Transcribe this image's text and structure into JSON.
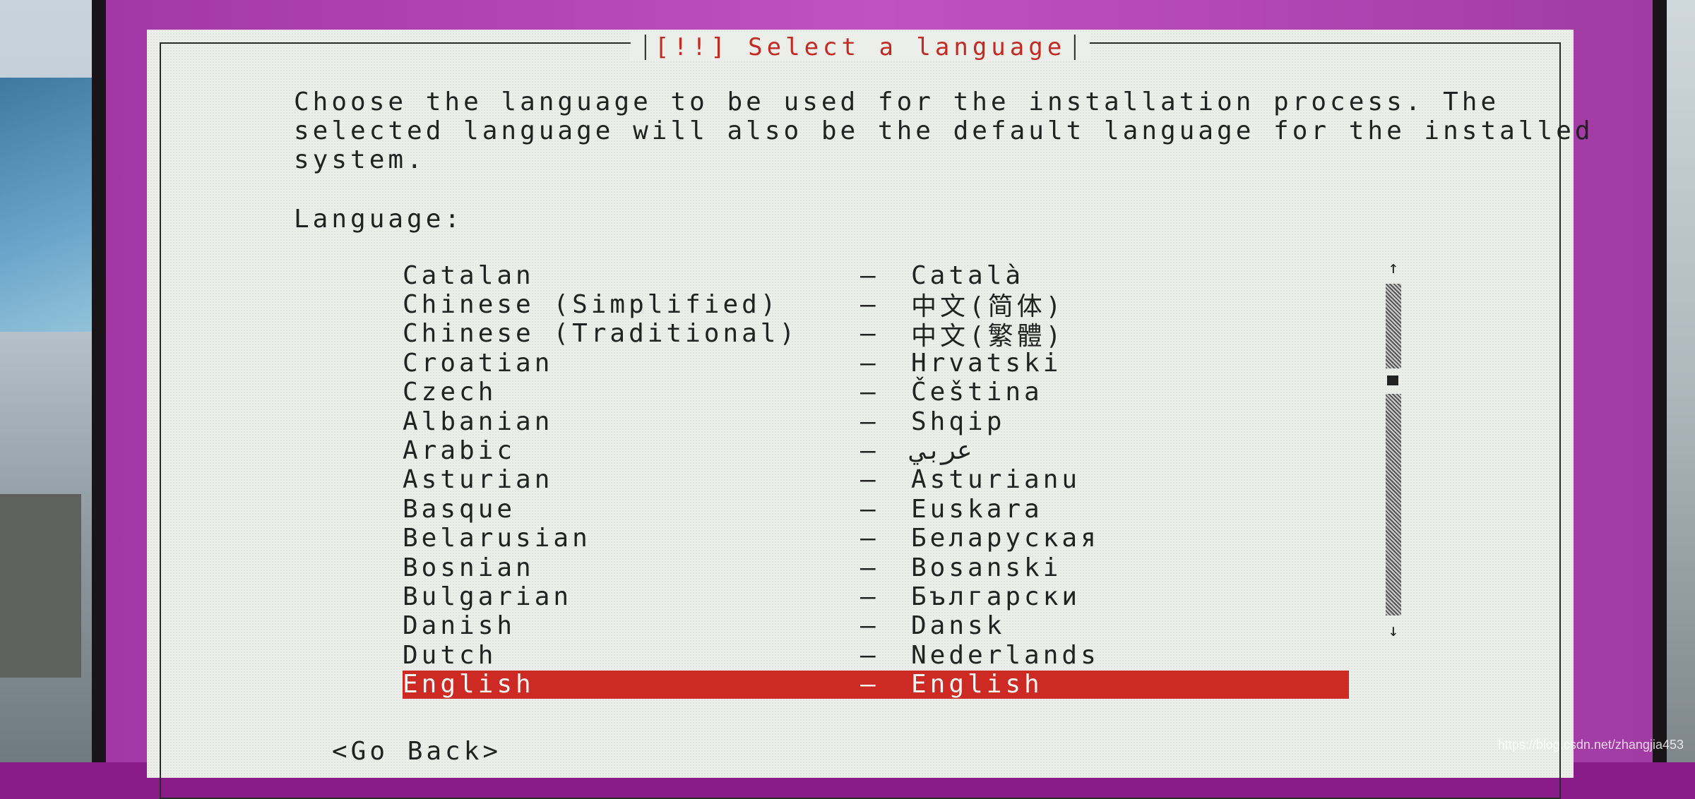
{
  "dialog": {
    "title": "[!!] Select a language",
    "description": "Choose the language to be used for the installation process. The\nselected language will also be the default language for the installed\nsystem.",
    "list_label": "Language:"
  },
  "languages": [
    {
      "name": "Catalan",
      "native": "Català"
    },
    {
      "name": "Chinese (Simplified)",
      "native": "中文(简体)"
    },
    {
      "name": "Chinese (Traditional)",
      "native": "中文(繁體)"
    },
    {
      "name": "Croatian",
      "native": "Hrvatski"
    },
    {
      "name": "Czech",
      "native": "Čeština"
    },
    {
      "name": "Albanian",
      "native": "Shqip"
    },
    {
      "name": "Arabic",
      "native": "عربي"
    },
    {
      "name": "Asturian",
      "native": "Asturianu"
    },
    {
      "name": "Basque",
      "native": "Euskara"
    },
    {
      "name": "Belarusian",
      "native": "Беларуская"
    },
    {
      "name": "Bosnian",
      "native": "Bosanski"
    },
    {
      "name": "Bulgarian",
      "native": "Български"
    },
    {
      "name": "Danish",
      "native": "Dansk"
    },
    {
      "name": "Dutch",
      "native": "Nederlands"
    },
    {
      "name": "English",
      "native": "English",
      "selected": true
    }
  ],
  "separator": "–",
  "scrollbar": {
    "up_arrow": "↑",
    "down_arrow": "↓"
  },
  "buttons": {
    "go_back": "<Go Back>"
  },
  "watermark": "https://blog.csdn.net/zhangjia453",
  "colors": {
    "title": "#c22a22",
    "selected_row": "#cc2a22",
    "dialog_bg": "#eceeea",
    "screen_bg": "#b042b4"
  }
}
